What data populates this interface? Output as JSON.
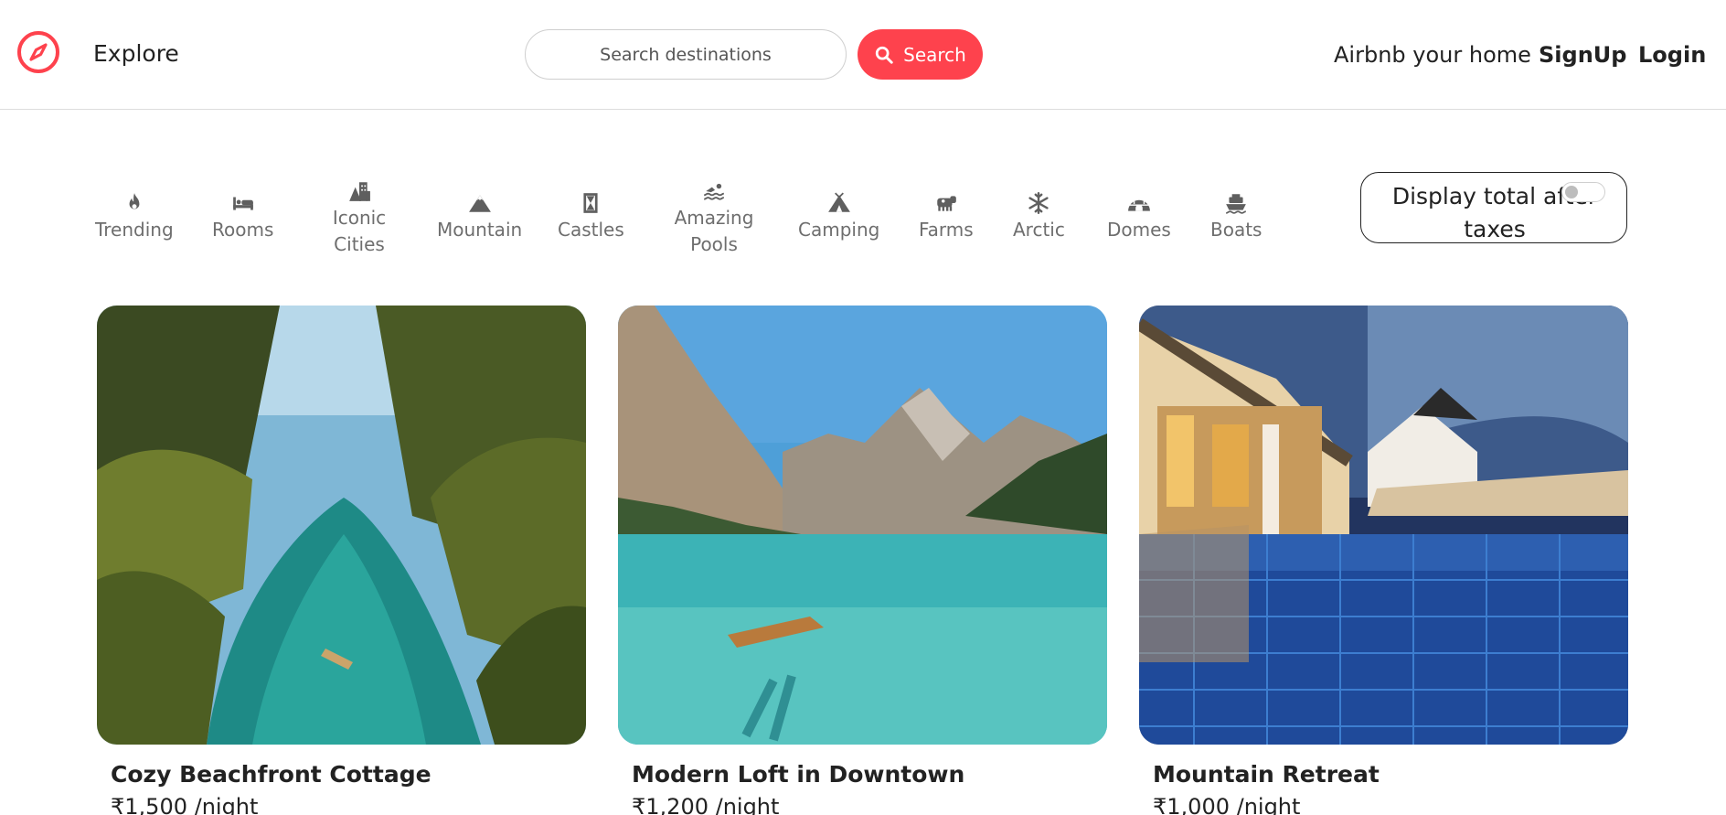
{
  "navbar": {
    "explore_label": "Explore",
    "search_placeholder": "Search destinations",
    "search_button_label": "Search",
    "airbnb_home_label": "Airbnb your home",
    "signup_label": "SignUp",
    "login_label": "Login"
  },
  "filters": [
    {
      "label": "Trending",
      "icon": "fire-icon"
    },
    {
      "label": "Rooms",
      "icon": "bed-icon"
    },
    {
      "label": "Iconic Cities",
      "icon": "city-icon"
    },
    {
      "label": "Mountain",
      "icon": "mountain-icon"
    },
    {
      "label": "Castles",
      "icon": "castle-icon"
    },
    {
      "label": "Amazing Pools",
      "icon": "swimmer-icon"
    },
    {
      "label": "Camping",
      "icon": "tent-icon"
    },
    {
      "label": "Farms",
      "icon": "cow-icon"
    },
    {
      "label": "Arctic",
      "icon": "snowflake-icon"
    },
    {
      "label": "Domes",
      "icon": "igloo-icon"
    },
    {
      "label": "Boats",
      "icon": "ship-icon"
    }
  ],
  "tax_toggle": {
    "label": "Display total after taxes",
    "enabled": false
  },
  "listings": [
    {
      "title": "Cozy Beachfront Cottage",
      "price": "₹1,500 /night"
    },
    {
      "title": "Modern Loft in Downtown",
      "price": "₹1,200 /night"
    },
    {
      "title": "Mountain Retreat",
      "price": "₹1,000 /night"
    }
  ],
  "colors": {
    "brand": "#fe424d",
    "text": "#222222",
    "muted": "#6e6e6e"
  }
}
